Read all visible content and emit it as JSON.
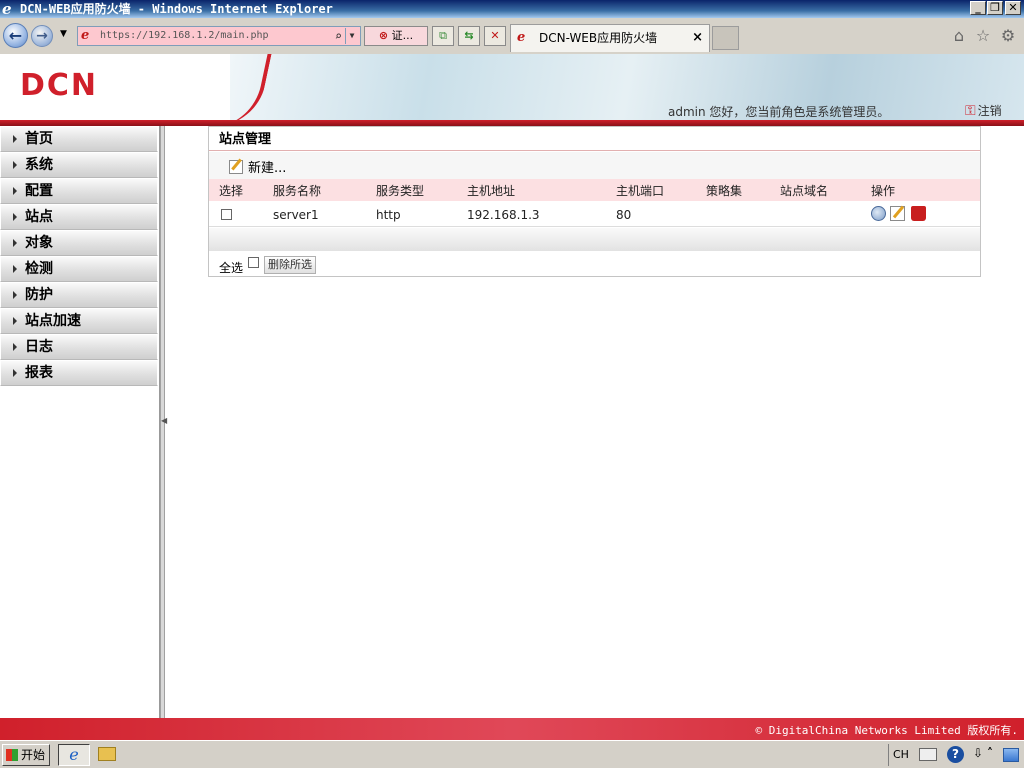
{
  "window": {
    "title": "DCN-WEB应用防火墙 - Windows Internet Explorer",
    "controls": [
      "_",
      "❐",
      "✕"
    ]
  },
  "browser": {
    "address": "https://192.168.1.2/main.php",
    "cert_label": "证...",
    "tab_title": "DCN-WEB应用防火墙",
    "tab_close": "×"
  },
  "header": {
    "logo": "DCN",
    "user_greeting": "admin 您好，您当前角色是系统管理员。",
    "logout": "注销"
  },
  "sidebar": {
    "items": [
      "首页",
      "系统",
      "配置",
      "站点",
      "对象",
      "检测",
      "防护",
      "站点加速",
      "日志",
      "报表"
    ]
  },
  "panel": {
    "title": "站点管理",
    "new_button": "新建...",
    "columns": [
      "选择",
      "服务名称",
      "服务类型",
      "主机地址",
      "主机端口",
      "策略集",
      "站点域名",
      "操作"
    ],
    "rows": [
      {
        "name": "server1",
        "type": "http",
        "host": "192.168.1.3",
        "port": "80",
        "policy": "",
        "domain": ""
      }
    ],
    "select_all": "全选",
    "delete_selected": "删除所选"
  },
  "footer": {
    "copyright": "© DigitalChina Networks Limited 版权所有."
  },
  "taskbar": {
    "start": "开始",
    "lang": "CH"
  },
  "colors": {
    "accent_red": "#d0202b",
    "header_pink": "#fce0e2"
  }
}
